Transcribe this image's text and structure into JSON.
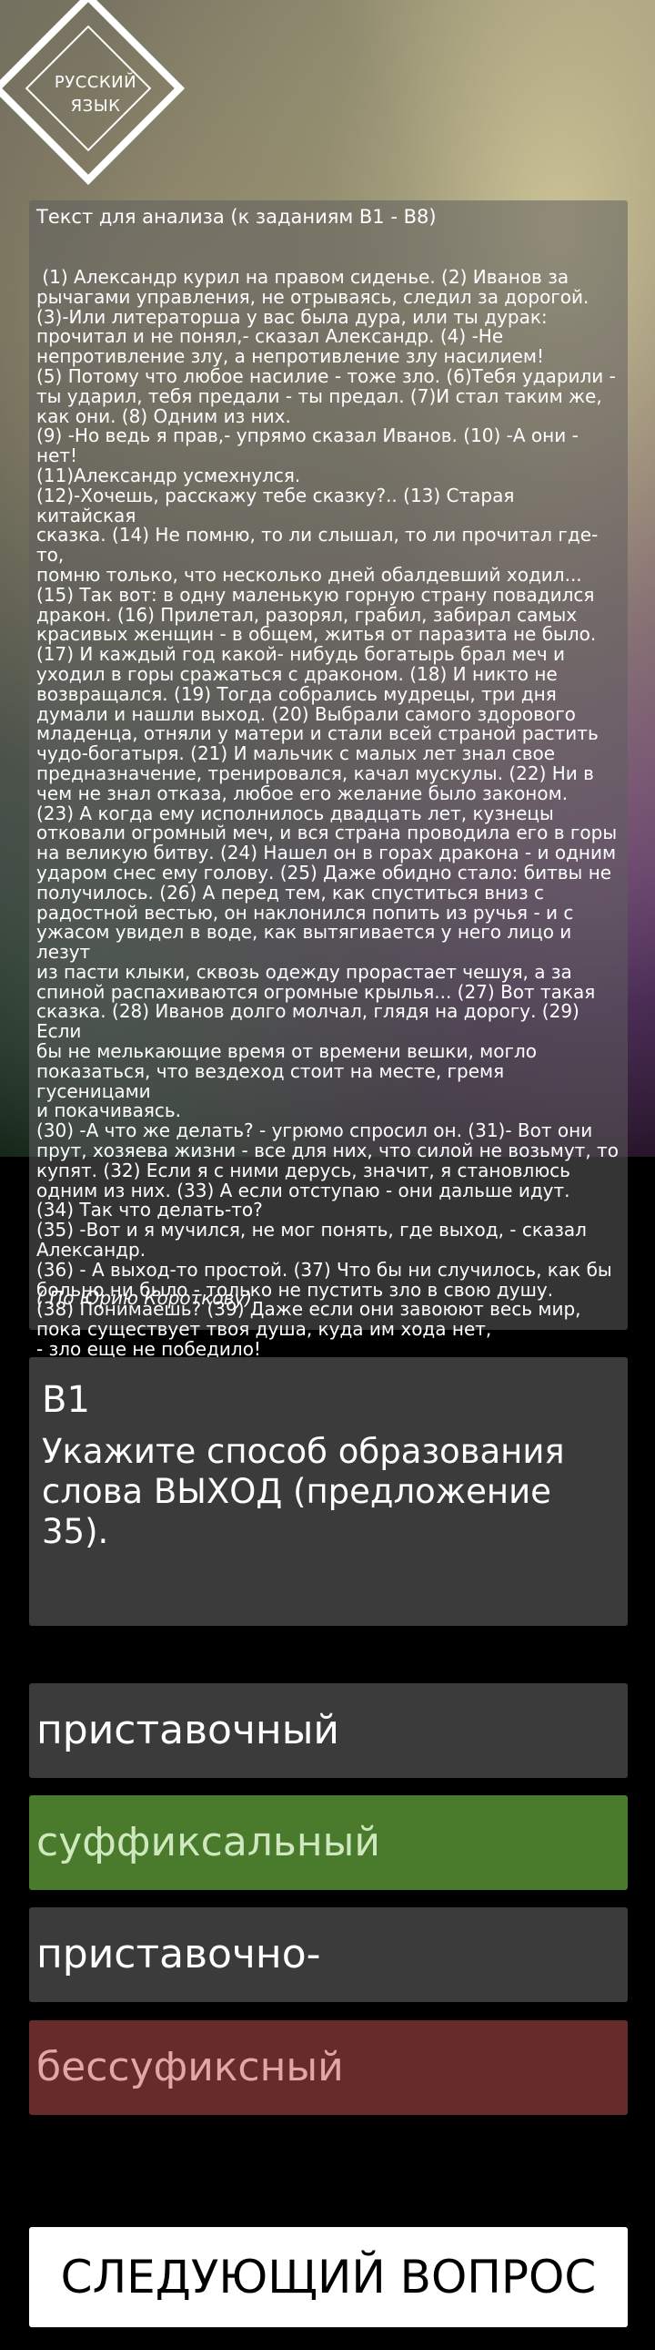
{
  "logo": {
    "line1": "РУССКИЙ",
    "line2": "ЯЗЫК"
  },
  "text_panel": {
    "title": "Текст для анализа (к заданиям В1 - В8)",
    "body": " (1) Александр курил на правом сиденье. (2) Иванов за\nрычагами управления, не отрываясь, следил за дорогой.\n(3)-Или литераторша у вас была дура, или ты дурак:\nпрочитал и не понял,- сказал Александр. (4) -Не\nнепротивление злу, а непротивление злу насилием!\n(5) Потому что любое насилие - тоже зло. (6)Тебя ударили -\nты ударил, тебя предали - ты предал. (7)И стал таким же,\nкак они. (8) Одним из них.\n(9) -Но ведь я прав,- упрямо сказал Иванов. (10) -А они -\nнет!\n(11)Александр усмехнулся.\n(12)-Хочешь, расскажу тебе сказку?.. (13) Старая китайская\nсказка. (14) Не помню, то ли слышал, то ли прочитал где-то,\nпомню только, что несколько дней обалдевший ходил...\n(15) Так вот: в одну маленькую горную страну повадился\nдракон. (16) Прилетал, разорял, грабил, забирал самых\nкрасивых женщин - в общем, житья от паразита не было.\n(17) И каждый год какой- нибудь богатырь брал меч и\nуходил в горы сражаться с драконом. (18) И никто не\nвозвращался. (19) Тогда собрались мудрецы, три дня\nдумали и нашли выход. (20) Выбрали самого здорового\nмладенца, отняли у матери и стали всей страной растить\nчудо-богатыря. (21) И мальчик с малых лет знал свое\nпредназначение, тренировался, качал мускулы. (22) Ни в\nчем не знал отказа, любое его желание было законом.\n(23) А когда ему исполнилось двадцать лет, кузнецы\nотковали огромный меч, и вся страна проводила его в горы\nна великую битву. (24) Нашел он в горах дракона - и одним\nударом снес ему голову. (25) Даже обидно стало: битвы не\nполучилось. (26) А перед тем, как спуститься вниз с\nрадостной вестью, он наклонился попить из ручья - и с\nужасом увидел в воде, как вытягивается у него лицо и лезут\nиз пасти клыки, сквозь одежду прорастает чешуя, а за\nспиной распахиваются огромные крылья... (27) Вот такая\nсказка. (28) Иванов долго молчал, глядя на дорогу. (29) Если\nбы не мелькающие время от времени вешки, могло\nпоказаться, что вездеход стоит на месте, гремя гусеницами\nи покачиваясь.\n(30) -А что же делать? - угрюмо спросил он. (31)- Вот они\nпрут, хозяева жизни - все для них, что силой не возьмут, то\nкупят. (32) Если я с ними дерусь, значит, я становлюсь\nодним из них. (33) А если отступаю - они дальше идут.\n(34) Так что делать-то?\n(35) -Вот и я мучился, не мог понять, где выход, - сказал\nАлександр.\n(36) - А выход-то простой. (37) Что бы ни случилось, как бы\nбольно ни было - только не пустить зло в свою душу.\n(38) Понимаешь? (39) Даже если они завоюют весь мир,\nпока существует твоя душа, куда им хода нет,\n- зло еще не победило!",
    "author": "( По Юрию Короткову)"
  },
  "question": {
    "number": "В1",
    "text": "Укажите способ образования слова ВЫХОД (предложение 35)."
  },
  "answers": [
    {
      "label": "приставочный",
      "state": "neutral",
      "color": "#3b3b3b"
    },
    {
      "label": "суффиксальный",
      "state": "correct",
      "color": "#4a7b2d"
    },
    {
      "label": "приставочно-суффиксальный",
      "state": "neutral",
      "color": "#3b3b3b"
    },
    {
      "label": "бессуфиксный",
      "state": "wrong",
      "color": "#672b2b"
    }
  ],
  "next_button": {
    "label": "СЛЕДУЮЩИЙ ВОПРОС"
  }
}
